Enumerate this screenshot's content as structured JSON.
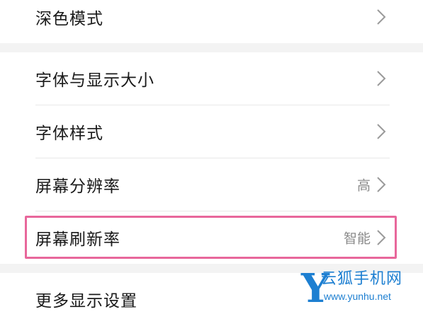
{
  "settings": {
    "items": [
      {
        "label": "深色模式",
        "value": ""
      },
      {
        "label": "字体与显示大小",
        "value": ""
      },
      {
        "label": "字体样式",
        "value": ""
      },
      {
        "label": "屏幕分辨率",
        "value": "高"
      },
      {
        "label": "屏幕刷新率",
        "value": "智能"
      },
      {
        "label": "更多显示设置",
        "value": ""
      }
    ]
  },
  "watermark": {
    "logo_letter": "Y",
    "name": "云狐手机网",
    "url": "www.yunhu.net"
  },
  "colors": {
    "highlight": "#e8679b",
    "watermark": "#1d7fd1",
    "section_gap": "#f3f3f3",
    "chevron": "#9a9a9a"
  },
  "icons": [
    "chevron-right-icon"
  ]
}
